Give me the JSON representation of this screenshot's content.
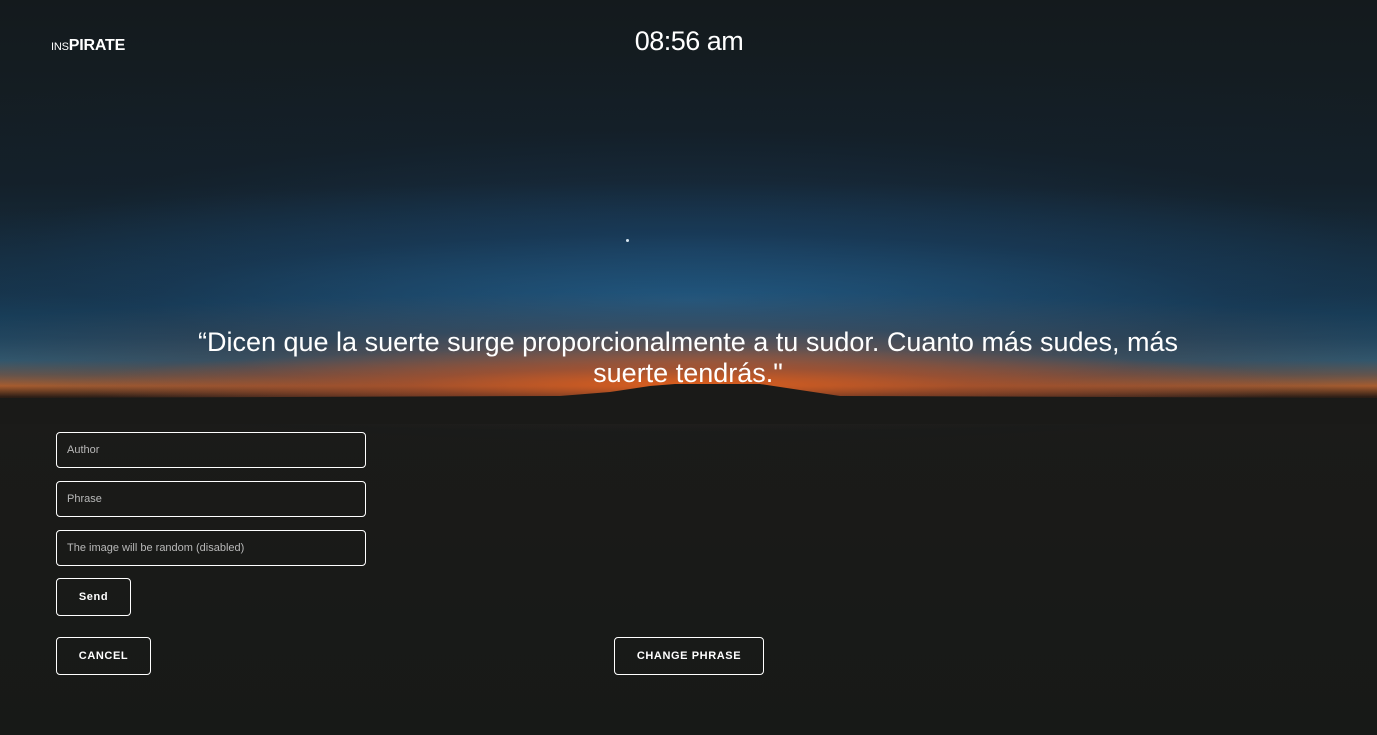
{
  "header": {
    "logo_prefix": "INS",
    "logo_main": "PIRATE",
    "time": "08:56 am"
  },
  "quote": {
    "text": "“Dicen que la suerte surge proporcionalmente a tu sudor. Cuanto más sudes, más suerte tendrás.\""
  },
  "form": {
    "author_placeholder": "Author",
    "phrase_placeholder": "Phrase",
    "image_placeholder": "The image will be random (disabled)",
    "send_label": "Send"
  },
  "actions": {
    "cancel_label": "CANCEL",
    "change_phrase_label": "CHANGE PHRASE"
  },
  "colors": {
    "background": "#171917",
    "horizon_orange": "#e8601a",
    "sky_blue": "#2c5f7a",
    "text": "#ffffff"
  }
}
